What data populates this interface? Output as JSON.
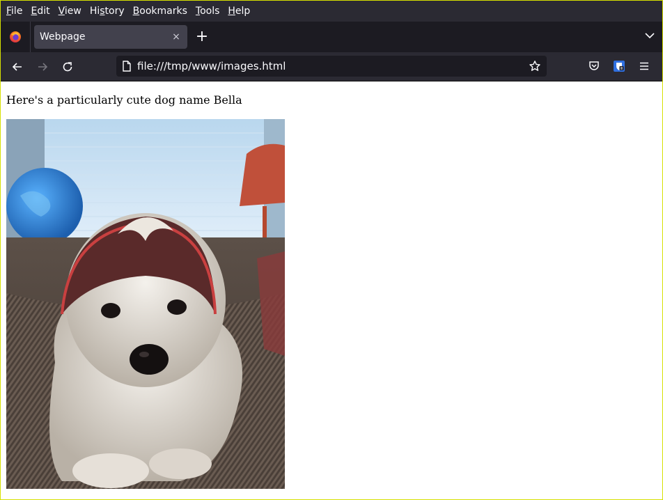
{
  "menu": {
    "items": [
      {
        "label": "File",
        "accel": "F",
        "rest": "ile"
      },
      {
        "label": "Edit",
        "accel": "E",
        "rest": "dit"
      },
      {
        "label": "View",
        "accel": "V",
        "rest": "iew"
      },
      {
        "label": "History",
        "pre": "Hi",
        "accel": "s",
        "rest": "tory"
      },
      {
        "label": "Bookmarks",
        "accel": "B",
        "rest": "ookmarks"
      },
      {
        "label": "Tools",
        "accel": "T",
        "rest": "ools"
      },
      {
        "label": "Help",
        "accel": "H",
        "rest": "elp"
      }
    ]
  },
  "tab": {
    "title": "Webpage",
    "close": "×"
  },
  "newtab": "+",
  "url": "file:///tmp/www/images.html",
  "page": {
    "paragraph": "Here's a particularly cute dog name Bella"
  },
  "colors": {
    "chrome_dark": "#1c1b22",
    "chrome": "#2b2a33",
    "tab_active": "#42414d",
    "text_light": "#fbfbfe",
    "border_yellow": "#d6e000"
  }
}
